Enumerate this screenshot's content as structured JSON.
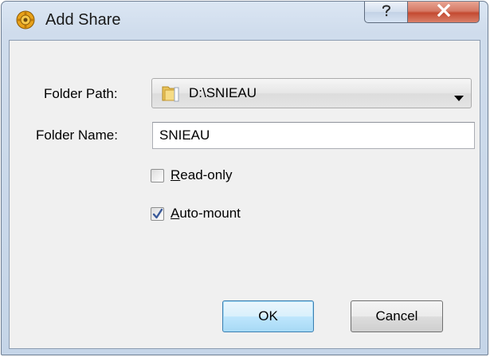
{
  "window": {
    "title": "Add Share",
    "title_icon": "gear-icon",
    "help_icon": "help-icon",
    "close_icon": "close-icon"
  },
  "form": {
    "folder_path_label": "Folder Path:",
    "folder_path_value": "D:\\SNIEAU",
    "folder_name_label": "Folder Name:",
    "folder_name_value": "SNIEAU",
    "read_only": {
      "mnemonic": "R",
      "rest": "ead-only",
      "checked": false
    },
    "auto_mount": {
      "mnemonic": "A",
      "rest": "uto-mount",
      "checked": true
    }
  },
  "buttons": {
    "ok_label": "OK",
    "cancel_label": "Cancel"
  },
  "colors": {
    "accent": "#3c7fb1",
    "close_button": "#c44a31",
    "check_mark": "#3a5a9a"
  }
}
